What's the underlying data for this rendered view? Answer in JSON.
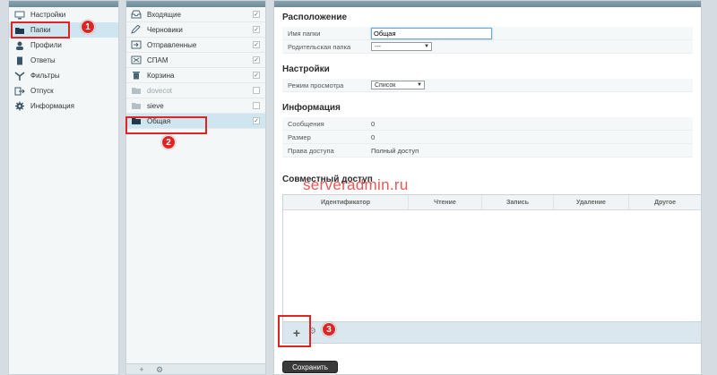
{
  "sidebar": {
    "items": [
      {
        "label": "Настройки",
        "icon": "monitor-icon"
      },
      {
        "label": "Папки",
        "icon": "folder-icon"
      },
      {
        "label": "Профили",
        "icon": "user-icon"
      },
      {
        "label": "Ответы",
        "icon": "document-icon"
      },
      {
        "label": "Фильтры",
        "icon": "filter-icon"
      },
      {
        "label": "Отпуск",
        "icon": "vacation-icon"
      },
      {
        "label": "Информация",
        "icon": "gear-icon"
      }
    ],
    "selected": "Папки"
  },
  "folders": {
    "items": [
      {
        "label": "Входящие",
        "icon": "inbox-icon",
        "checked": true,
        "muted": false
      },
      {
        "label": "Черновики",
        "icon": "pencil-icon",
        "checked": true,
        "muted": false
      },
      {
        "label": "Отправленные",
        "icon": "sent-icon",
        "checked": true,
        "muted": false
      },
      {
        "label": "СПАМ",
        "icon": "spam-icon",
        "checked": true,
        "muted": false
      },
      {
        "label": "Корзина",
        "icon": "trash-icon",
        "checked": true,
        "muted": false
      },
      {
        "label": "dovecot",
        "icon": "folder-icon",
        "checked": false,
        "muted": true
      },
      {
        "label": "sieve",
        "icon": "folder-icon",
        "checked": false,
        "muted": false
      },
      {
        "label": "Общая",
        "icon": "folder-icon",
        "checked": true,
        "muted": false
      }
    ],
    "selected": "Общая"
  },
  "main": {
    "location": {
      "title": "Расположение",
      "folder_name_label": "Имя папки",
      "folder_name_value": "Общая",
      "parent_label": "Родительская папка",
      "parent_value": "---"
    },
    "settings": {
      "title": "Настройки",
      "view_mode_label": "Режим просмотра",
      "view_mode_value": "Список"
    },
    "info": {
      "title": "Информация",
      "messages_label": "Сообщения",
      "messages_value": "0",
      "size_label": "Размер",
      "size_value": "0",
      "rights_label": "Права доступа",
      "rights_value": "Полный доступ"
    },
    "sharing": {
      "title": "Совместный доступ",
      "columns": [
        "Идентификатор",
        "Чтение",
        "Запись",
        "Удаление",
        "Другое"
      ]
    },
    "save_label": "Сохранить"
  },
  "watermark": "serveradmin.ru",
  "annotations": [
    "1",
    "2",
    "3"
  ],
  "colors": {
    "selected_bg": "#cfe6f1",
    "annotation_red": "#e02424",
    "header_bar": "#7b95a3"
  }
}
